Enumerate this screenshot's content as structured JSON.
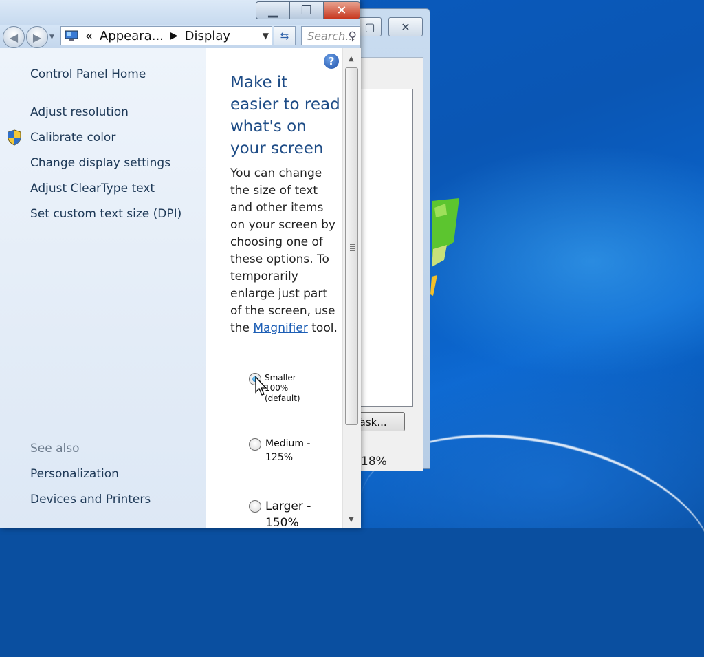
{
  "window": {
    "breadcrumb": [
      "Appeara...",
      "Display"
    ],
    "breadcrumb_prefix": "«",
    "search_placeholder": "Search..."
  },
  "sidebar": {
    "home_link": "Control Panel Home",
    "tasks": [
      "Adjust resolution",
      "Calibrate color",
      "Change display settings",
      "Adjust ClearType text",
      "Set custom text size (DPI)"
    ],
    "see_also_heading": "See also",
    "see_also": [
      "Personalization",
      "Devices and Printers"
    ]
  },
  "content": {
    "heading": "Make it easier to read what's on your screen",
    "description_before": "You can change the size of text and other items on your screen by choosing one of these options. To temporarily enlarge just part of the screen, use the ",
    "link_text": "Magnifier",
    "description_after": " tool.",
    "options": [
      {
        "label": "Smaller - 100% (default)",
        "selected": true
      },
      {
        "label": "Medium - 125%",
        "selected": false
      },
      {
        "label": "Larger - 150%",
        "selected": false
      }
    ]
  },
  "background_window": {
    "button_label": "Task...",
    "status_text": "18%"
  },
  "colors": {
    "heading_blue": "#1e4c86",
    "link_blue": "#1c5eb5",
    "sidebar_text": "#1e3957",
    "desktop_blue": "#0b5cc0"
  }
}
